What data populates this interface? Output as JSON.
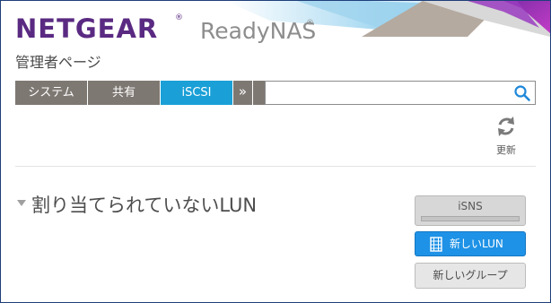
{
  "header": {
    "logo_text": "NETGEAR",
    "logo_reg": "®",
    "product_name": "ReadyNAS",
    "product_reg": "®",
    "subtitle": "管理者ページ"
  },
  "nav": {
    "tabs": [
      {
        "label": "システム",
        "active": false
      },
      {
        "label": "共有",
        "active": false
      },
      {
        "label": "iSCSI",
        "active": true
      }
    ],
    "more_label": "»",
    "accent_color": "#1aa0d7",
    "tab_color": "#7e7873"
  },
  "search": {
    "value": "",
    "placeholder": "",
    "icon": "search-icon"
  },
  "toolbar": {
    "refresh_label": "更新",
    "refresh_icon": "refresh-icon"
  },
  "section": {
    "title": "割り当てられていないLUN",
    "collapse_icon": "triangle-down-icon"
  },
  "buttons": {
    "isns_label": "iSNS",
    "new_lun_label": "新しいLUN",
    "new_lun_icon": "lun-icon",
    "new_group_label": "新しいグループ"
  },
  "colors": {
    "brand_purple": "#5a2a82",
    "primary_button": "#1e92e6"
  }
}
